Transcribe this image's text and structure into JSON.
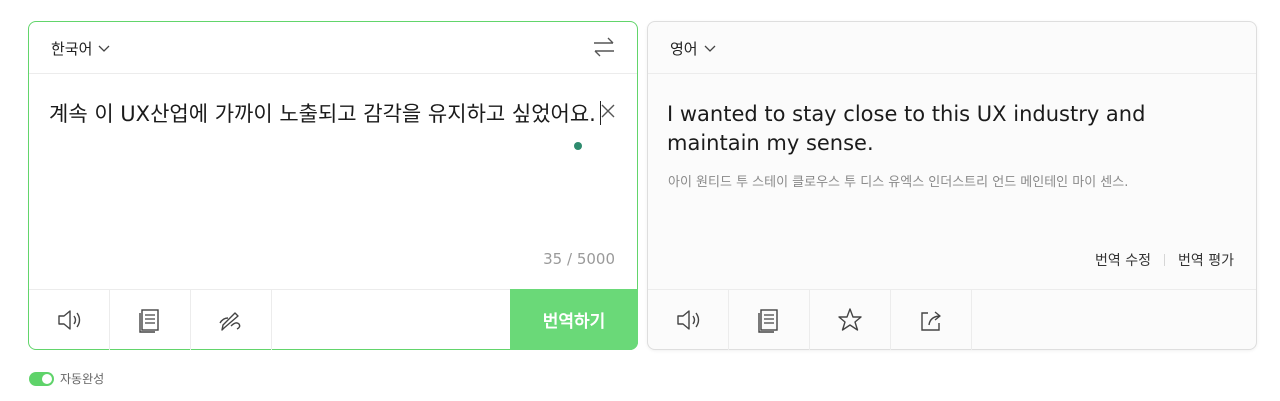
{
  "source": {
    "language": "한국어",
    "text": "계속 이 UX산업에 가까이 노출되고 감각을 유지하고 싶었어요.",
    "char_count": "35 / 5000",
    "translate_label": "번역하기",
    "tools": [
      "speaker-icon",
      "dictionary-icon",
      "handwriting-icon"
    ]
  },
  "target": {
    "language": "영어",
    "text": "I wanted to stay close to this UX industry and maintain my sense.",
    "pronunciation": "아이 원티드 투 스테이 클로우스 투 디스 유엑스 인더스트리 언드 메인테인 마이 센스.",
    "edit_label": "번역 수정",
    "rate_label": "번역 평가",
    "tools": [
      "speaker-icon",
      "dictionary-icon",
      "star-icon",
      "share-icon"
    ]
  },
  "autocomplete": {
    "label": "자동완성",
    "enabled": true
  },
  "colors": {
    "accent": "#6ad978",
    "accent_border": "#62d56b",
    "grammar_dot": "#2e8b6e"
  }
}
